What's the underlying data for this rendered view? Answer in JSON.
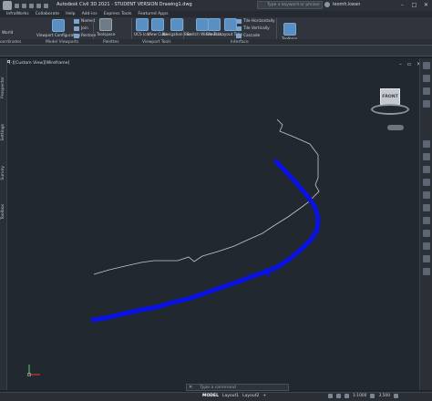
{
  "titlebar": {
    "title": "Autodesk Civil 3D 2021 - STUDENT VERSION   Drawing1.dwg",
    "search_placeholder": "Type a keyword or phrase",
    "user": "leomh.kwan"
  },
  "menu": [
    "InfraWorks",
    "Collaborate",
    "Help",
    "Add-ins",
    "Express Tools",
    "Featured Apps"
  ],
  "ribbon": {
    "world_label": "World",
    "coordinates_label": "oordinates",
    "viewport_config": "Viewport Configuration",
    "named": "Named",
    "join": "Join",
    "restore": "Restore",
    "toolspace": "Toolspace",
    "ucs_icon": "UCS Icon",
    "view_cube": "View Cube",
    "navigation_bar": "Navigation Bar",
    "switch_windows": "Switch Windows",
    "file_tabs": "File Tabs",
    "layout_tabs": "Layout Tabs",
    "tile_horizontally": "Tile Horizontally",
    "tile_vertically": "Tile Vertically",
    "cascade": "Cascade",
    "toolbars": "Toolbars",
    "panels": [
      "Model Viewports",
      "Palettes",
      "Viewport Tools",
      "Interface"
    ]
  },
  "viewport": {
    "label": "[-][Custom View][Wireframe]",
    "cube_face": "FRONT"
  },
  "left_tabs": [
    "Prospector",
    "Settings",
    "Survey",
    "Toolbox"
  ],
  "command": {
    "placeholder": "Type a command"
  },
  "statusbar": {
    "tabs": [
      "MODEL",
      "Layout1",
      "Layout2"
    ],
    "scale": "1:1000",
    "value": "3.500"
  },
  "colors": {
    "alignment": "#0a12e6",
    "polyline": "#c8c8c8",
    "canvas": "#212830"
  }
}
